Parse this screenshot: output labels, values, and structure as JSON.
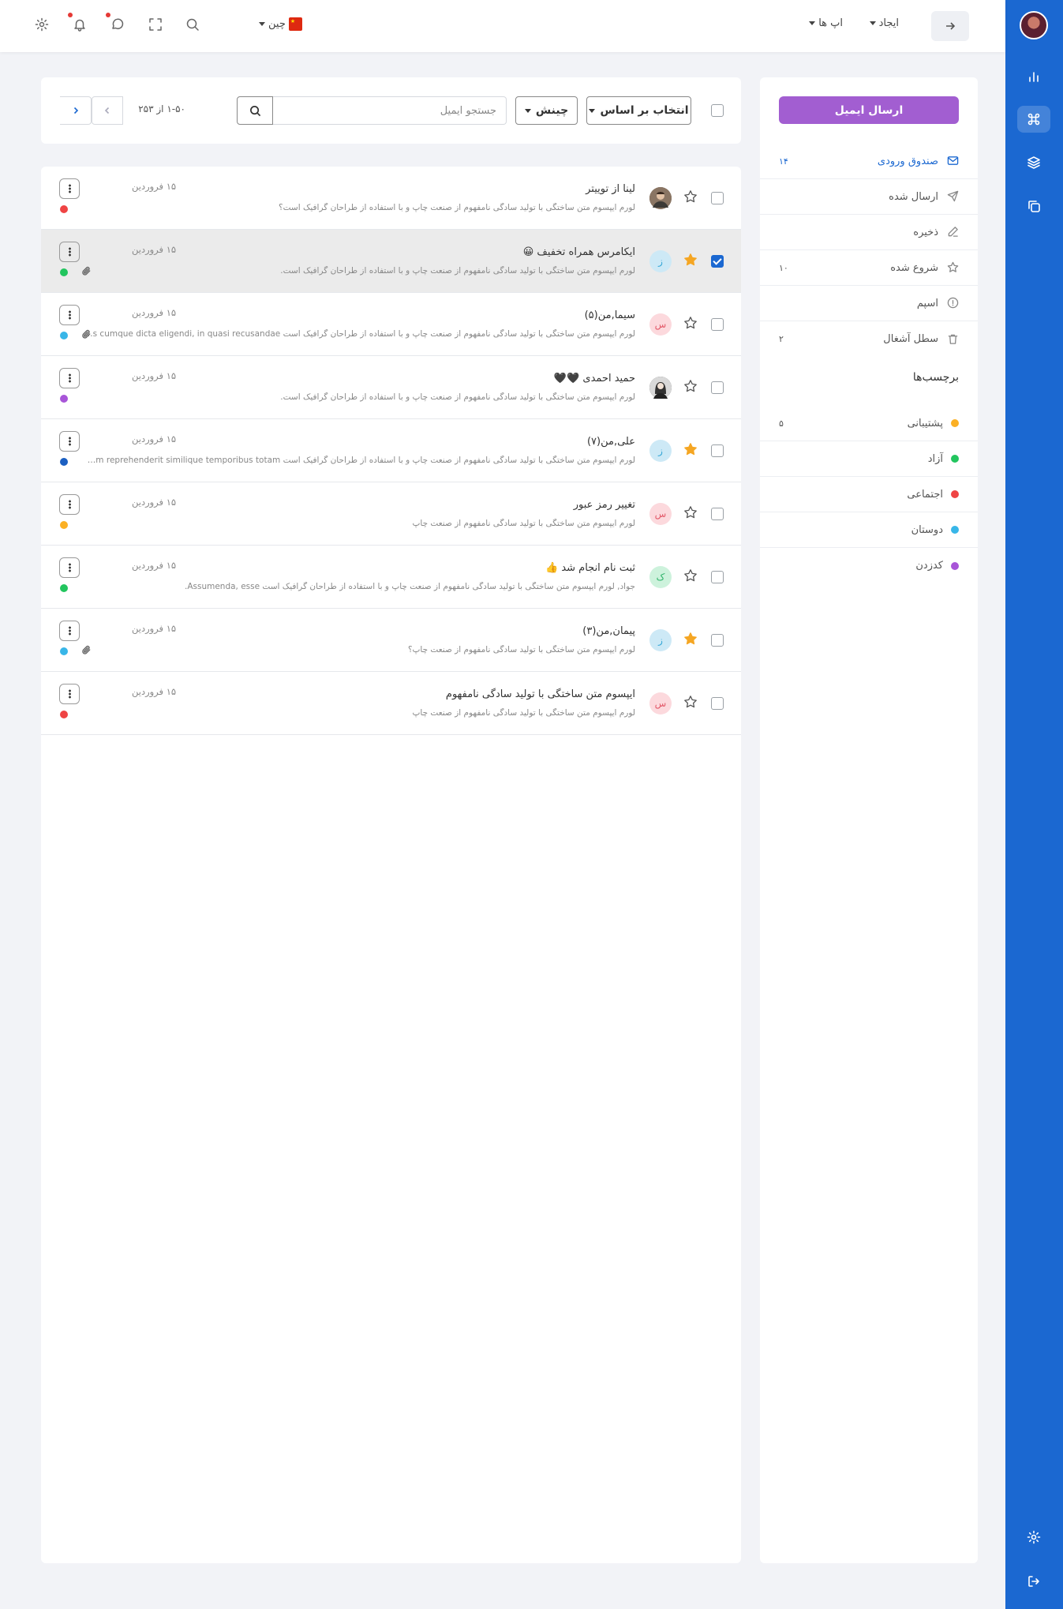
{
  "header": {
    "create_label": "ایجاد",
    "apps_label": "اپ ها",
    "language_label": "چین"
  },
  "sidebar": {
    "compose_label": "ارسال ایمیل",
    "folders": [
      {
        "label": "صندوق ورودی",
        "count": "۱۴",
        "icon": "mail-icon",
        "active": true
      },
      {
        "label": "ارسال شده",
        "count": "",
        "icon": "send-icon",
        "active": false
      },
      {
        "label": "ذخیره",
        "count": "",
        "icon": "pencil-icon",
        "active": false
      },
      {
        "label": "شروع شده",
        "count": "۱۰",
        "icon": "star-icon",
        "active": false
      },
      {
        "label": "اسپم",
        "count": "",
        "icon": "info-icon",
        "active": false
      },
      {
        "label": "سطل آشغال",
        "count": "۲",
        "icon": "trash-icon",
        "active": false
      }
    ],
    "labels_title": "برچسب‌ها",
    "labels": [
      {
        "label": "پشتیبانی",
        "count": "۵",
        "color": "#fbb024"
      },
      {
        "label": "آزاد",
        "count": "",
        "color": "#22c55e"
      },
      {
        "label": "اجتماعی",
        "count": "",
        "color": "#ef4444"
      },
      {
        "label": "دوستان",
        "count": "",
        "color": "#38b6e8"
      },
      {
        "label": "کدزدن",
        "count": "",
        "color": "#a855d8"
      }
    ]
  },
  "toolbar": {
    "select_label": "انتخاب بر اساس",
    "sort_label": "چینش",
    "search_placeholder": "جستجو ایمیل",
    "pagination_text": "۱-۵۰ از ۲۵۳"
  },
  "emails": [
    {
      "title": "لینا از توییتر",
      "snippet": "لورم ایپسوم متن ساختگی با تولید سادگی نامفهوم از صنعت چاپ و با استفاده از طراحان گرافیک است؟",
      "date": "۱۵ فروردین",
      "starred": false,
      "selected": false,
      "avatar_text": "",
      "avatar_kind": "photo-man",
      "avatar_bg": "#6b5a4a",
      "avatar_fg": "#fff",
      "dot_color": "#ef4444",
      "attachment": false
    },
    {
      "title": "ایکامرس همراه تخفیف 😀",
      "snippet": "لورم ایپسوم متن ساختگی با تولید سادگی نامفهوم از صنعت چاپ و با استفاده از طراحان گرافیک است.",
      "date": "۱۵ فروردین",
      "starred": true,
      "selected": true,
      "avatar_text": "ز",
      "avatar_kind": "letter",
      "avatar_bg": "#cde9f6",
      "avatar_fg": "#38a8d8",
      "dot_color": "#22c55e",
      "attachment": true
    },
    {
      "title": "سیما,من(۵)",
      "snippet": "لورم ایپسوم متن ساختگی با تولید سادگی نامفهوم از صنعت چاپ و با استفاده از طراحان گرافیک است ris cumque dicta eligendi, in quasi recusandae...",
      "date": "۱۵ فروردین",
      "starred": false,
      "selected": false,
      "avatar_text": "س",
      "avatar_kind": "letter",
      "avatar_bg": "#fcd9dd",
      "avatar_fg": "#e35a6a",
      "dot_color": "#38b6e8",
      "attachment": true
    },
    {
      "title": "حمید احمدی 🖤🖤",
      "snippet": "لورم ایپسوم متن ساختگی با تولید سادگی نامفهوم از صنعت چاپ و با استفاده از طراحان گرافیک است.",
      "date": "۱۵ فروردین",
      "starred": false,
      "selected": false,
      "avatar_text": "",
      "avatar_kind": "photo-woman",
      "avatar_bg": "#2b2b2b",
      "avatar_fg": "#fff",
      "dot_color": "#a855d8",
      "attachment": false
    },
    {
      "title": "علی,من(۷)",
      "snippet": "لورم ایپسوم متن ساختگی با تولید سادگی نامفهوم از صنعت چاپ و با استفاده از طراحان گرافیک است ione rem reprehenderit similique temporibus totam...",
      "date": "۱۵ فروردین",
      "starred": true,
      "selected": false,
      "avatar_text": "ز",
      "avatar_kind": "letter",
      "avatar_bg": "#cde9f6",
      "avatar_fg": "#38a8d8",
      "dot_color": "#1b5fc1",
      "attachment": false
    },
    {
      "title": "تغییر رمز عبور",
      "snippet": "لورم ایپسوم متن ساختگی با تولید سادگی نامفهوم از صنعت چاپ",
      "date": "۱۵ فروردین",
      "starred": false,
      "selected": false,
      "avatar_text": "س",
      "avatar_kind": "letter",
      "avatar_bg": "#fcd9dd",
      "avatar_fg": "#e35a6a",
      "dot_color": "#fbb024",
      "attachment": false
    },
    {
      "title": "ثبت نام انجام شد 👍",
      "snippet": "جواد, لورم ایپسوم متن ساختگی با تولید سادگی نامفهوم از صنعت چاپ و با استفاده از طراحان گرافیک است Assumenda, esse.",
      "date": "۱۵ فروردین",
      "starred": false,
      "selected": false,
      "avatar_text": "ک",
      "avatar_kind": "letter",
      "avatar_bg": "#cdf2dc",
      "avatar_fg": "#2fb36a",
      "dot_color": "#22c55e",
      "attachment": false
    },
    {
      "title": "پیمان,من(۳)",
      "snippet": "لورم ایپسوم متن ساختگی با تولید سادگی نامفهوم از صنعت چاپ؟",
      "date": "۱۵ فروردین",
      "starred": true,
      "selected": false,
      "avatar_text": "ز",
      "avatar_kind": "letter",
      "avatar_bg": "#cde9f6",
      "avatar_fg": "#38a8d8",
      "dot_color": "#38b6e8",
      "attachment": true
    },
    {
      "title": "ایپسوم متن ساختگی با تولید سادگی نامفهوم",
      "snippet": "لورم ایپسوم متن ساختگی با تولید سادگی نامفهوم از صنعت چاپ",
      "date": "۱۵ فروردین",
      "starred": false,
      "selected": false,
      "avatar_text": "س",
      "avatar_kind": "letter",
      "avatar_bg": "#fcd9dd",
      "avatar_fg": "#e35a6a",
      "dot_color": "#ef4444",
      "attachment": false
    }
  ],
  "colors": {
    "primary": "#1b68d1",
    "compose": "#a25ed1",
    "star_active": "#f5a623"
  }
}
